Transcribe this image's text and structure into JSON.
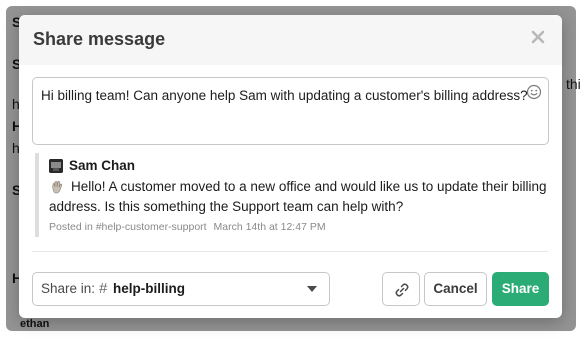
{
  "modal": {
    "title": "Share message",
    "close_label": "×"
  },
  "compose": {
    "text": "Hi billing team! Can anyone help Sam with updating a customer's billing address?",
    "emoji_icon": "smiley-icon"
  },
  "quote": {
    "author": "Sam Chan",
    "line1": "Hello! A customer moved to a new office and would like us to update their billing",
    "line2": "address. Is this something the Support team can help with?",
    "posted_in": "Posted in #help-customer-support",
    "timestamp": "March 14th at 12:47 PM"
  },
  "footer": {
    "share_in_label": "Share in:",
    "hash": "#",
    "channel": "help-billing",
    "cancel_label": "Cancel",
    "share_label": "Share",
    "link_icon": "link-icon"
  },
  "colors": {
    "accent": "#2bac76",
    "header_bg": "#f6f6f6"
  }
}
